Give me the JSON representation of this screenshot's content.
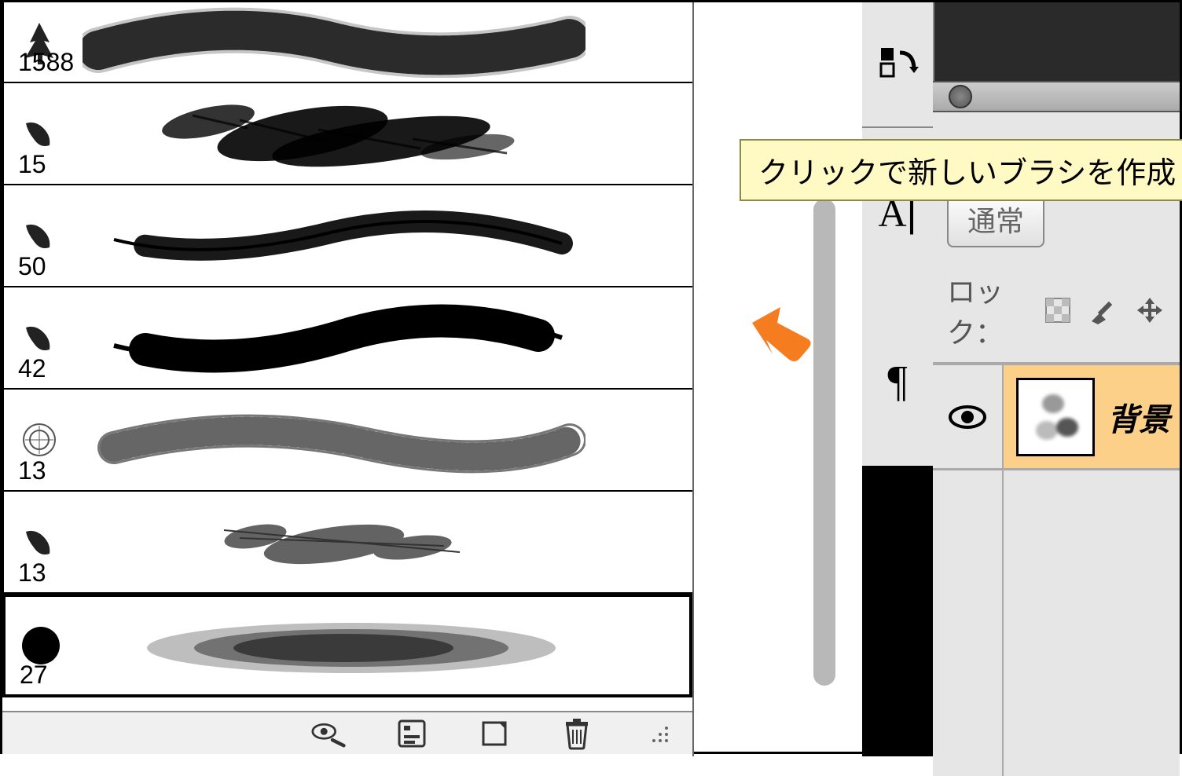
{
  "brush_panel": {
    "brushes": [
      {
        "size": "1588",
        "thumb": "tree-brush",
        "stroke_type": "fuzzy-wave"
      },
      {
        "size": "15",
        "thumb": "leaf-brush",
        "stroke_type": "scatter"
      },
      {
        "size": "50",
        "thumb": "leaf-brush",
        "stroke_type": "ink-thin-wave"
      },
      {
        "size": "42",
        "thumb": "leaf-brush",
        "stroke_type": "ink-thick-wave"
      },
      {
        "size": "13",
        "thumb": "circle-pattern",
        "stroke_type": "rope"
      },
      {
        "size": "13",
        "thumb": "leaf-brush",
        "stroke_type": "scatter-sparse"
      },
      {
        "size": "27",
        "thumb": "round-solid",
        "stroke_type": "soft-cloud",
        "selected": true
      }
    ],
    "toolbar_icons": [
      "eye-brush-icon",
      "new-preset-icon",
      "new-icon",
      "delete-icon",
      "resize-icon"
    ]
  },
  "tooltip": {
    "text": "クリックで新しいブラシを作成"
  },
  "side_tools": {
    "top_icon": "color-swap-icon",
    "icons": [
      "char-tool-icon",
      "paragraph-tool-icon"
    ],
    "char_label": "A",
    "para_label": "¶"
  },
  "layers_panel": {
    "blend_mode": "通常",
    "lock_label": "ロック：",
    "lock_icons": [
      "transparency-lock-icon",
      "paint-lock-icon",
      "move-lock-icon"
    ],
    "layer": {
      "name": "背景",
      "visible": true
    }
  }
}
